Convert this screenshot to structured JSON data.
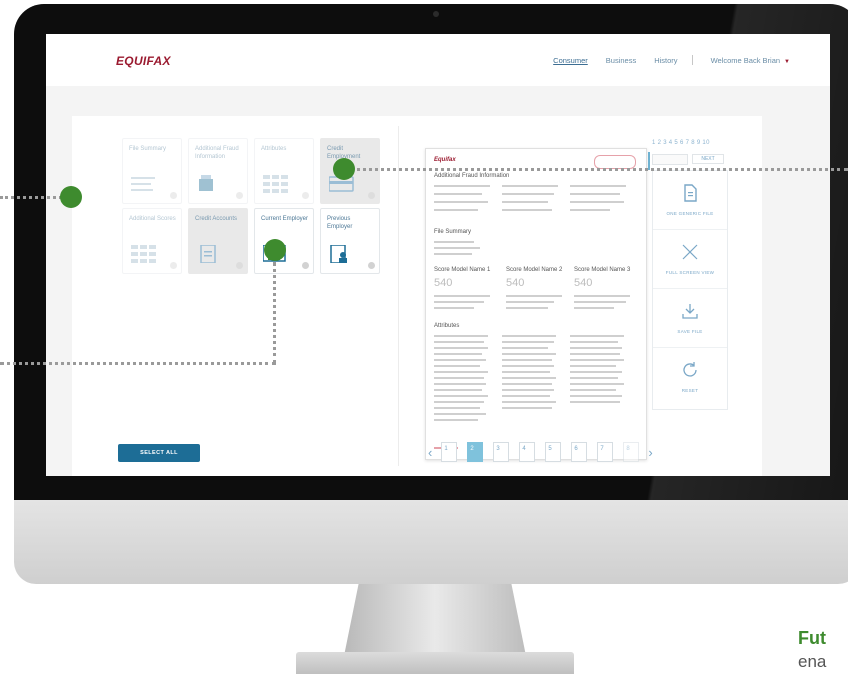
{
  "header": {
    "logo": "EQUIFAX",
    "nav": [
      {
        "label": "Consumer",
        "active": true
      },
      {
        "label": "Business",
        "active": false
      },
      {
        "label": "History",
        "active": false
      }
    ],
    "user_menu": "Welcome Back Brian"
  },
  "tiles": [
    {
      "label": "File Summary",
      "state": "faded"
    },
    {
      "label": "Additional Fraud Information",
      "state": "faded"
    },
    {
      "label": "Attributes",
      "state": "faded"
    },
    {
      "label": "Credit Employment",
      "state": "faded-gray"
    },
    {
      "label": "Additional Scores",
      "state": "faded"
    },
    {
      "label": "Credit Accounts",
      "state": "faded-gray"
    },
    {
      "label": "Current Employer",
      "state": "normal"
    },
    {
      "label": "Previous Employer",
      "state": "normal"
    }
  ],
  "select_all_label": "SELECT ALL",
  "document": {
    "logo": "Equifax",
    "headings": [
      "Additional Fraud Information",
      "File Summary",
      "Score Model Name 1",
      "Score Model Name 2",
      "Score Model Name 3",
      "Attributes"
    ],
    "scores": [
      "540",
      "540",
      "540"
    ]
  },
  "pager": {
    "pages": [
      "1",
      "2",
      "3",
      "4",
      "5",
      "6",
      "7",
      "8"
    ],
    "active_index": 1
  },
  "right_panel": {
    "page_indices": "1 2 3 4 5 6 7 8 9 10",
    "next_label": "NEXT",
    "tools": [
      {
        "label": "ONE GENERIC FILE",
        "icon": "document-icon"
      },
      {
        "label": "FULL SCREEN VIEW",
        "icon": "fullscreen-icon"
      },
      {
        "label": "SAVE FILE",
        "icon": "download-icon"
      },
      {
        "label": "RESET",
        "icon": "refresh-icon"
      }
    ]
  },
  "promo": {
    "title": "Fut",
    "subtitle": "ena"
  },
  "colors": {
    "brand": "#9b1b30",
    "primary": "#1d6d96",
    "accent_green": "#3e8b2e"
  }
}
